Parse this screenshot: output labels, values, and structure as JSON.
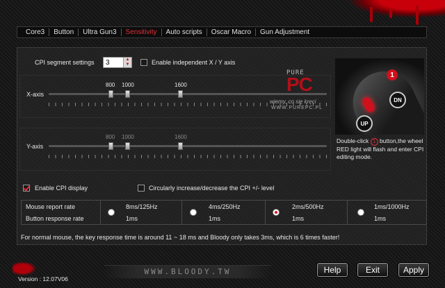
{
  "tabs": [
    {
      "label": "Core3",
      "active": false
    },
    {
      "label": "Button",
      "active": false
    },
    {
      "label": "Ultra Gun3",
      "active": false
    },
    {
      "label": "Sensitivity",
      "active": true
    },
    {
      "label": "Auto scripts",
      "active": false
    },
    {
      "label": "Oscar Macro",
      "active": false
    },
    {
      "label": "Gun Adjustment",
      "active": false
    }
  ],
  "cpi": {
    "segment_label": "CPI segment settings",
    "segment_value": "3",
    "independent_xy_label": "Enable independent X / Y axis",
    "independent_xy_checked": false
  },
  "x_axis": {
    "label": "X-axis",
    "values": [
      "800",
      "1000",
      "1600"
    ],
    "enabled": true
  },
  "y_axis": {
    "label": "Y-axis",
    "values": [
      "800",
      "1000",
      "1600"
    ],
    "enabled": false
  },
  "watermark": {
    "line1": "PURE",
    "line2": "PC",
    "line3": "wiemy, co się kręci",
    "line4": "WWW.PUREPC.PL"
  },
  "info": {
    "badge_number": "1",
    "badge_dn": "DN",
    "badge_up": "UP",
    "text_before": "Double-click",
    "text_circled": "1",
    "text_after": "button,the wheel RED light will flash and enter CPI editing mode."
  },
  "options": {
    "enable_cpi_display_label": "Enable CPI display",
    "enable_cpi_display_checked": true,
    "circular_label": "Circularly increase/decrease the CPI +/- level",
    "circular_checked": false
  },
  "rates": {
    "row_labels": [
      "Mouse report rate",
      "Button response rate"
    ],
    "options": [
      {
        "report": "8ms/125Hz",
        "response": "1ms",
        "selected": false
      },
      {
        "report": "4ms/250Hz",
        "response": "1ms",
        "selected": false
      },
      {
        "report": "2ms/500Hz",
        "response": "1ms",
        "selected": true
      },
      {
        "report": "1ms/1000Hz",
        "response": "1ms",
        "selected": false
      }
    ]
  },
  "footer_note": "For normal mouse, the key response time is around 11 ~ 18 ms and Bloody only takes 3ms, which is 6 times faster!",
  "url": "WWW.BLOODY.TW",
  "version": "Version : 12.07V06",
  "buttons": {
    "help": "Help",
    "exit": "Exit",
    "apply": "Apply"
  },
  "colors": {
    "accent": "#e0303a",
    "background": "#151515",
    "blood": "#c8000a"
  }
}
